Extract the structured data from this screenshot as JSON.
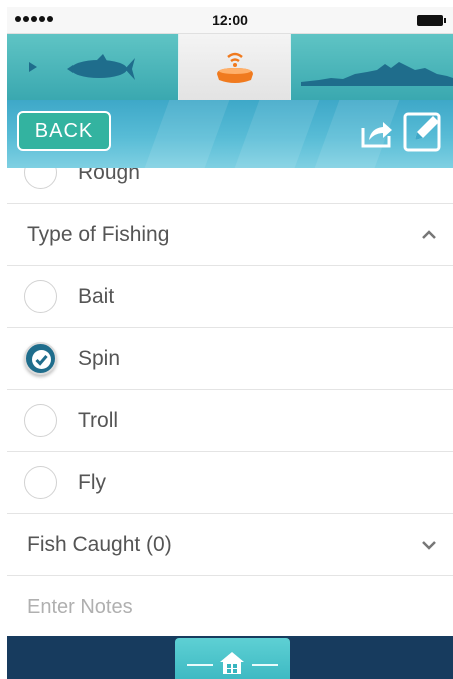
{
  "status_bar": {
    "time": "12:00"
  },
  "header": {
    "back_label": "BACK"
  },
  "icons": {
    "share": "share-icon",
    "edit": "edit-icon",
    "home": "home-icon",
    "fish": "fish-icon",
    "sonar": "sonar-icon",
    "terrain": "terrain-icon"
  },
  "list": {
    "partial_row_label": "Rough",
    "type_of_fishing": {
      "header": "Type of Fishing",
      "expanded": true,
      "options": [
        {
          "label": "Bait",
          "checked": false
        },
        {
          "label": "Spin",
          "checked": true
        },
        {
          "label": "Troll",
          "checked": false
        },
        {
          "label": "Fly",
          "checked": false
        }
      ]
    },
    "fish_caught": {
      "header": "Fish Caught (0)",
      "expanded": false
    },
    "notes": {
      "placeholder": "Enter Notes"
    }
  },
  "colors": {
    "accent_teal": "#33b3a0",
    "header_blue": "#3ea8c8",
    "bottom_navy": "#173b5e",
    "check_blue": "#1f6d8c",
    "sonar_orange": "#f07a1e"
  }
}
